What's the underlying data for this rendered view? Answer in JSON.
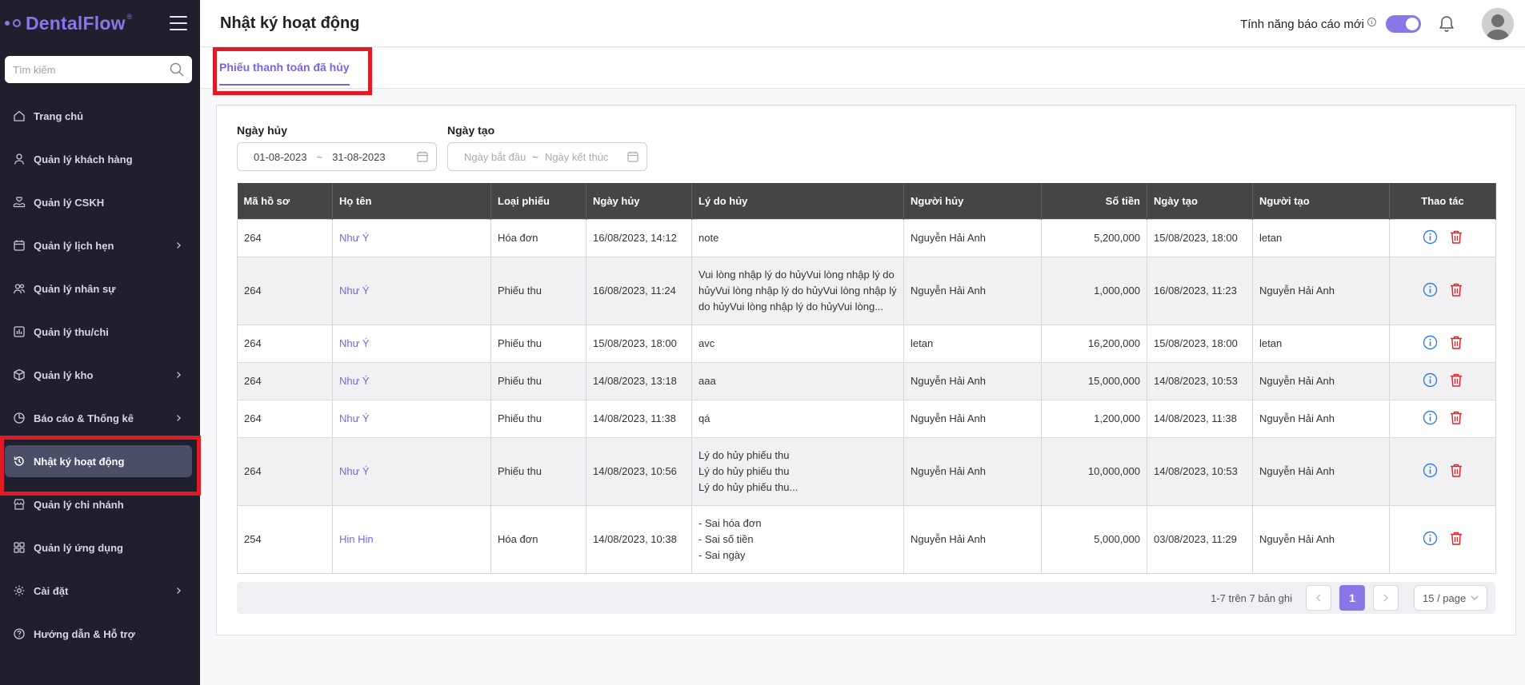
{
  "brand": {
    "name": "DentalFlow",
    "reg": "®"
  },
  "search": {
    "placeholder": "Tìm kiếm"
  },
  "sidebar": {
    "items": [
      {
        "label": "Trang chủ",
        "icon": "home-icon"
      },
      {
        "label": "Quản lý khách hàng",
        "icon": "user-icon"
      },
      {
        "label": "Quản lý CSKH",
        "icon": "hand-heart-icon"
      },
      {
        "label": "Quản lý lịch hẹn",
        "icon": "calendar-icon",
        "expandable": true
      },
      {
        "label": "Quản lý nhân sự",
        "icon": "users-icon"
      },
      {
        "label": "Quản lý thu/chi",
        "icon": "bar-chart-icon"
      },
      {
        "label": "Quản lý kho",
        "icon": "box-icon",
        "expandable": true
      },
      {
        "label": "Báo cáo & Thống kê",
        "icon": "pie-chart-icon",
        "expandable": true
      },
      {
        "label": "Nhật ký hoạt động",
        "icon": "history-icon",
        "active": true
      },
      {
        "label": "Quản lý chi nhánh",
        "icon": "store-icon"
      },
      {
        "label": "Quản lý ứng dụng",
        "icon": "apps-icon"
      },
      {
        "label": "Cài đặt",
        "icon": "gear-icon",
        "expandable": true
      },
      {
        "label": "Hướng dẫn & Hỗ trợ",
        "icon": "help-icon"
      }
    ]
  },
  "header": {
    "title": "Nhật ký hoạt động",
    "feature_label": "Tính năng báo cáo mới",
    "feature_info": "i",
    "feature_enabled": true
  },
  "tabs": [
    {
      "label": "Phiếu thanh toán đã hủy",
      "active": true
    }
  ],
  "filters": {
    "cancel_date": {
      "label": "Ngày hủy",
      "start": "01-08-2023",
      "end": "31-08-2023",
      "sep": "~"
    },
    "created_date": {
      "label": "Ngày tạo",
      "start_placeholder": "Ngày bắt đầu",
      "end_placeholder": "Ngày kết thúc",
      "sep": "~"
    }
  },
  "table": {
    "columns": [
      "Mã hồ sơ",
      "Họ tên",
      "Loại phiếu",
      "Ngày hủy",
      "Lý do hủy",
      "Người hủy",
      "Số tiền",
      "Ngày tạo",
      "Người tạo",
      "Thao tác"
    ],
    "rows": [
      {
        "code": "264",
        "name": "Như Ý",
        "type": "Hóa đơn",
        "cancel_date": "16/08/2023, 14:12",
        "reason": "note",
        "canceled_by": "Nguyễn Hải Anh",
        "amount": "5,200,000",
        "created": "15/08/2023, 18:00",
        "creator": "letan"
      },
      {
        "code": "264",
        "name": "Như Ý",
        "type": "Phiếu thu",
        "cancel_date": "16/08/2023, 11:24",
        "reason": "Vui lòng nhập lý do hủyVui lòng nhập lý do hủyVui lòng nhập lý do hủyVui lòng nhập lý do hủyVui lòng nhập lý do hủyVui lòng...",
        "canceled_by": "Nguyễn Hải Anh",
        "amount": "1,000,000",
        "created": "16/08/2023, 11:23",
        "creator": "Nguyễn Hải Anh"
      },
      {
        "code": "264",
        "name": "Như Ý",
        "type": "Phiếu thu",
        "cancel_date": "15/08/2023, 18:00",
        "reason": "avc",
        "canceled_by": "letan",
        "amount": "16,200,000",
        "created": "15/08/2023, 18:00",
        "creator": "letan"
      },
      {
        "code": "264",
        "name": "Như Ý",
        "type": "Phiếu thu",
        "cancel_date": "14/08/2023, 13:18",
        "reason": "aaa",
        "canceled_by": "Nguyễn Hải Anh",
        "amount": "15,000,000",
        "created": "14/08/2023, 10:53",
        "creator": "Nguyễn Hải Anh"
      },
      {
        "code": "264",
        "name": "Như Ý",
        "type": "Phiếu thu",
        "cancel_date": "14/08/2023, 11:38",
        "reason": "qá",
        "canceled_by": "Nguyễn Hải Anh",
        "amount": "1,200,000",
        "created": "14/08/2023, 11:38",
        "creator": "Nguyễn Hải Anh"
      },
      {
        "code": "264",
        "name": "Như Ý",
        "type": "Phiếu thu",
        "cancel_date": "14/08/2023, 10:56",
        "reason": "Lý do hủy phiếu thu\nLý do hủy phiếu thu\nLý do hủy phiếu thu...",
        "canceled_by": "Nguyễn Hải Anh",
        "amount": "10,000,000",
        "created": "14/08/2023, 10:53",
        "creator": "Nguyễn Hải Anh"
      },
      {
        "code": "254",
        "name": "Hin Hin",
        "type": "Hóa đơn",
        "cancel_date": "14/08/2023, 10:38",
        "reason": "- Sai hóa đơn\n- Sai số tiền\n- Sai ngày",
        "canceled_by": "Nguyễn Hải Anh",
        "amount": "5,000,000",
        "created": "03/08/2023, 11:29",
        "creator": "Nguyễn Hải Anh"
      }
    ]
  },
  "pagination": {
    "summary": "1-7 trên 7 bản ghi",
    "current_page": "1",
    "page_size": "15 / page"
  },
  "colors": {
    "accent": "#8b76e8",
    "sidebar_bg": "#1f1f2e",
    "danger": "#e01b24",
    "info": "#2f7fe0"
  }
}
